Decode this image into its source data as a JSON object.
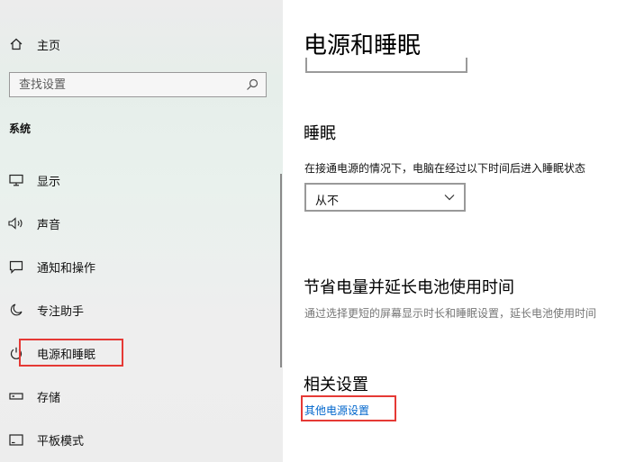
{
  "sidebar": {
    "home_label": "主页",
    "search_placeholder": "查找设置",
    "section_label": "系统",
    "items": [
      {
        "label": "显示",
        "icon": "monitor-icon"
      },
      {
        "label": "声音",
        "icon": "speaker-icon"
      },
      {
        "label": "通知和操作",
        "icon": "notification-icon"
      },
      {
        "label": "专注助手",
        "icon": "moon-icon"
      },
      {
        "label": "电源和睡眠",
        "icon": "power-icon",
        "selected": true
      },
      {
        "label": "存储",
        "icon": "storage-icon"
      },
      {
        "label": "平板模式",
        "icon": "tablet-icon"
      }
    ]
  },
  "main": {
    "title": "电源和睡眠",
    "sleep_heading": "睡眠",
    "sleep_desc": "在接通电源的情况下，电脑在经过以下时间后进入睡眠状态",
    "sleep_value": "从不",
    "save_heading": "节省电量并延长电池使用时间",
    "save_desc": "通过选择更短的屏幕显示时长和睡眠设置，延长电池使用时间",
    "related_heading": "相关设置",
    "related_link": "其他电源设置"
  },
  "colors": {
    "highlight": "#e53935",
    "link": "#0066cc"
  }
}
